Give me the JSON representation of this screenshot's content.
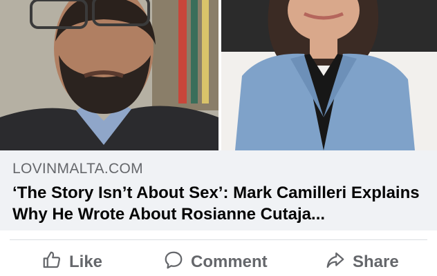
{
  "link_preview": {
    "domain": "LOVINMALTA.COM",
    "headline": "‘The Story Isn’t About Sex’: Mark Camilleri Explains Why He Wrote About Rosianne Cutaja..."
  },
  "actions": {
    "like_label": "Like",
    "comment_label": "Comment",
    "share_label": "Share"
  },
  "icons": {
    "like": "thumbs-up-icon",
    "comment": "speech-bubble-icon",
    "share": "share-arrow-icon"
  },
  "colors": {
    "action_text": "#65676b",
    "preview_bg": "#f0f2f5",
    "headline_text": "#050505"
  }
}
